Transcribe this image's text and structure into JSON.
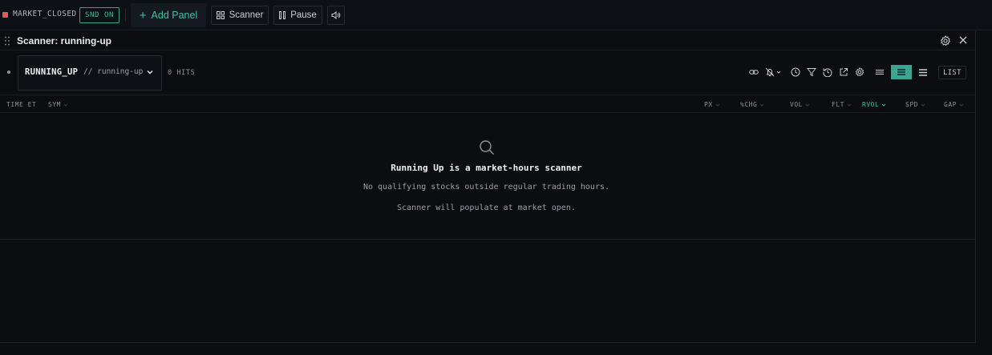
{
  "topbar": {
    "market_status": "MARKET_CLOSED",
    "sound_toggle": "SND ON",
    "add_panel": "Add Panel",
    "scanner_button": "Scanner",
    "pause_button": "Pause"
  },
  "panel": {
    "title": "Scanner: running-up",
    "scanner": {
      "name": "RUNNING_UP",
      "slug": "// running-up",
      "hits": "0 HITS"
    },
    "view_mode": "LIST",
    "columns": [
      "TIME ET",
      "SYM",
      "PX",
      "%CHG",
      "VOL",
      "FLT",
      "RVOL",
      "SPD",
      "GAP"
    ],
    "active_sort_column": "RVOL",
    "empty_state": {
      "title": "Running Up is a market-hours scanner",
      "line1": "No qualifying stocks outside regular trading hours.",
      "line2": "Scanner will populate at market open."
    }
  },
  "colors": {
    "accent": "#3ac1a4",
    "closed_indicator": "#e35959",
    "background": "#0b0d10"
  },
  "icons": [
    "drag-grip-icon",
    "gear-icon",
    "close-icon",
    "chevron-down-icon",
    "link-icon",
    "bell-off-icon",
    "clock-icon",
    "filter-icon",
    "history-icon",
    "external-link-icon",
    "settings-icon",
    "search-icon",
    "grid-icon",
    "pause-icon",
    "speaker-icon",
    "plus-icon"
  ]
}
